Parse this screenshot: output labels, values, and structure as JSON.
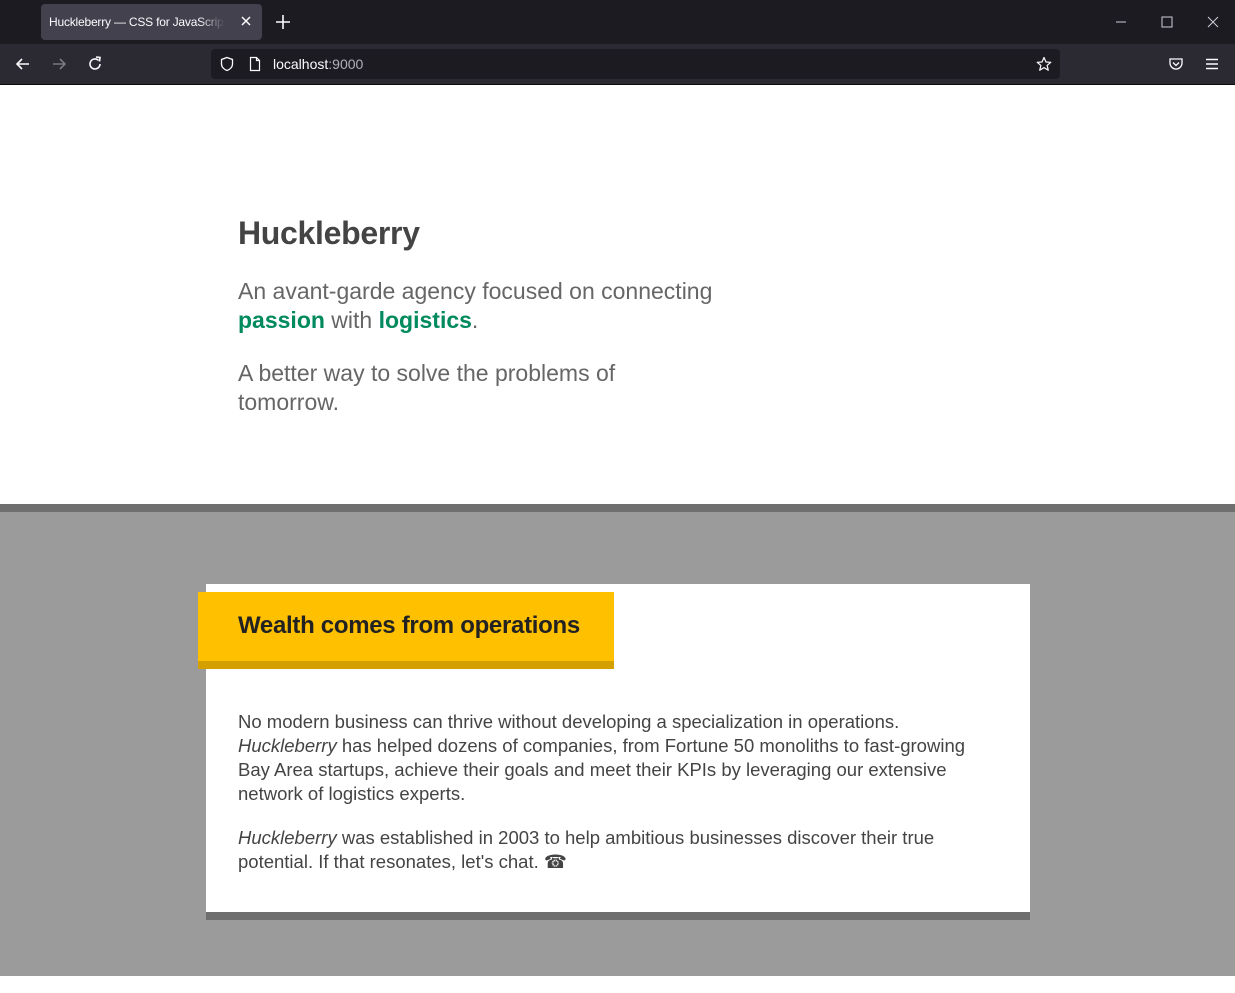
{
  "browser": {
    "tab_title": "Huckleberry — CSS for JavaScript Developers",
    "url_host": "localhost",
    "url_port": ":9000"
  },
  "hero": {
    "brand": "Huckleberry",
    "tagline_prefix": "An avant-garde agency focused on connecting ",
    "tagline_highlight_1": "passion",
    "tagline_middle": " with ",
    "tagline_highlight_2": "logistics",
    "tagline_suffix": ".",
    "sub": "A better way to solve the problems of tomorrow."
  },
  "card": {
    "banner": "Wealth comes from operations",
    "p1_text_a": "No modern business can thrive without developing a specialization in operations. ",
    "p1_em": "Huckleberry",
    "p1_text_b": " has helped dozens of companies, from Fortune 50 monoliths to fast-growing Bay Area startups, achieve their goals and meet their KPIs by leveraging our extensive network of logistics experts.",
    "p2_em": "Huckleberry",
    "p2_text": " was established in 2003 to help ambitious businesses discover their true potential. If that resonates, let's chat. ",
    "p2_glyph": "☎"
  },
  "colors": {
    "accent_green": "#008a5e",
    "banner_yellow": "#ffc000",
    "section_grey": "#9b9b9b"
  }
}
